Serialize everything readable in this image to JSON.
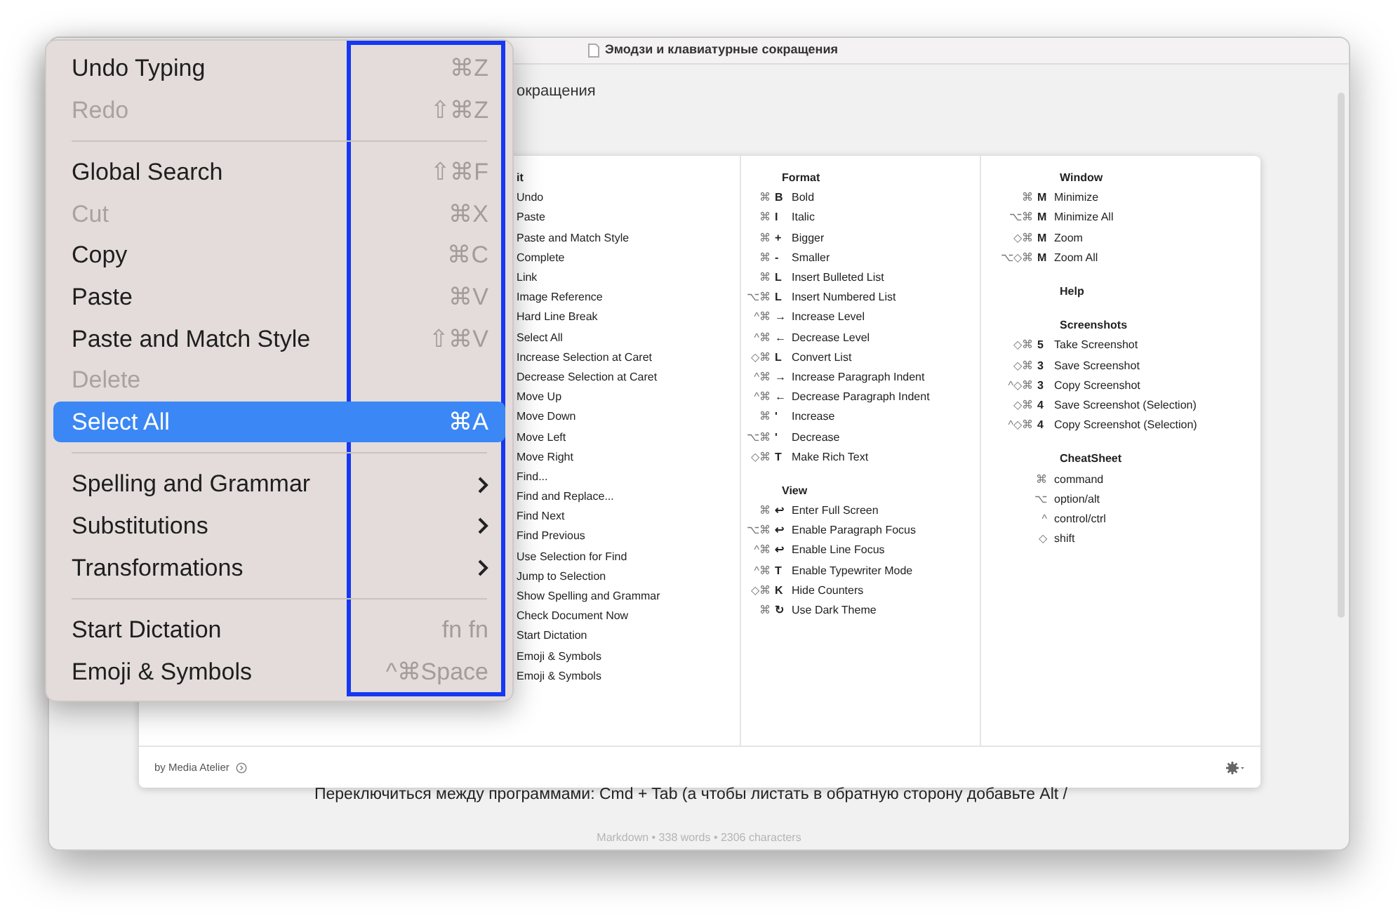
{
  "window": {
    "title": "Эмодзи и клавиатурные сокращения"
  },
  "document": {
    "heading": "окращения",
    "paragraph": "Переключиться между программами: Cmd + Tab (а чтобы листать в обратную сторону добавьте Alt /"
  },
  "cheatsheet": {
    "columns": [
      {
        "sections": [
          {
            "title": "it",
            "items": [
              {
                "label": "Undo"
              },
              {
                "label": "Paste"
              },
              {
                "label": "Paste and Match Style"
              },
              {
                "label": "Complete"
              },
              {
                "label": "Link"
              },
              {
                "label": "Image Reference"
              },
              {
                "label": "Hard Line Break"
              },
              {
                "label": "Select All"
              },
              {
                "label": "Increase Selection at Caret"
              },
              {
                "label": "Decrease Selection at Caret"
              },
              {
                "label": "Move Up"
              },
              {
                "label": "Move Down"
              },
              {
                "label": "Move Left"
              },
              {
                "label": "Move Right"
              },
              {
                "label": "Find..."
              },
              {
                "label": "Find and Replace..."
              },
              {
                "label": "Find Next"
              },
              {
                "label": "Find Previous"
              },
              {
                "label": "Use Selection for Find"
              },
              {
                "label": "Jump to Selection"
              },
              {
                "label": "Show Spelling and Grammar"
              },
              {
                "label": "Check Document Now"
              },
              {
                "label": "Start Dictation"
              },
              {
                "label": "Emoji & Symbols"
              },
              {
                "label": "Emoji & Symbols"
              }
            ]
          }
        ]
      },
      {
        "sections": [
          {
            "title": "Format",
            "items": [
              {
                "mods": "⌘",
                "key": "B",
                "label": "Bold"
              },
              {
                "mods": "⌘",
                "key": "I",
                "label": "Italic"
              },
              {
                "mods": "⌘",
                "key": "+",
                "label": "Bigger"
              },
              {
                "mods": "⌘",
                "key": "-",
                "label": "Smaller"
              },
              {
                "mods": "⌘",
                "key": "L",
                "label": "Insert Bulleted List"
              },
              {
                "mods": "⌥⌘",
                "key": "L",
                "label": "Insert Numbered List"
              },
              {
                "mods": "^⌘",
                "key": "→",
                "label": "Increase Level"
              },
              {
                "mods": "^⌘",
                "key": "←",
                "label": "Decrease Level"
              },
              {
                "mods": "◇⌘",
                "key": "L",
                "label": "Convert List"
              },
              {
                "mods": "^⌘",
                "key": "→",
                "label": "Increase Paragraph Indent"
              },
              {
                "mods": "^⌘",
                "key": "←",
                "label": "Decrease Paragraph Indent"
              },
              {
                "mods": "⌘",
                "key": "'",
                "label": "Increase"
              },
              {
                "mods": "⌥⌘",
                "key": "'",
                "label": "Decrease"
              },
              {
                "mods": "◇⌘",
                "key": "T",
                "label": "Make Rich Text"
              }
            ]
          },
          {
            "title": "View",
            "items": [
              {
                "mods": "⌘",
                "key": "↩",
                "label": "Enter Full Screen"
              },
              {
                "mods": "⌥⌘",
                "key": "↩",
                "label": "Enable Paragraph Focus"
              },
              {
                "mods": "^⌘",
                "key": "↩",
                "label": "Enable Line Focus"
              },
              {
                "mods": "^⌘",
                "key": "T",
                "label": "Enable Typewriter Mode"
              },
              {
                "mods": "◇⌘",
                "key": "K",
                "label": "Hide Counters"
              },
              {
                "mods": "⌘",
                "key": "↻",
                "label": "Use Dark Theme"
              }
            ]
          }
        ]
      },
      {
        "sections": [
          {
            "title": "Window",
            "items": [
              {
                "mods": "⌘",
                "key": "M",
                "label": "Minimize"
              },
              {
                "mods": "⌥⌘",
                "key": "M",
                "label": "Minimize All"
              },
              {
                "mods": "◇⌘",
                "key": "M",
                "label": "Zoom"
              },
              {
                "mods": "⌥◇⌘",
                "key": "M",
                "label": "Zoom All"
              }
            ]
          },
          {
            "title": "Help"
          },
          {
            "title": "Screenshots",
            "items": [
              {
                "mods": "◇⌘",
                "key": "5",
                "label": "Take Screenshot"
              },
              {
                "mods": "◇⌘",
                "key": "3",
                "label": "Save Screenshot"
              },
              {
                "mods": "^◇⌘",
                "key": "3",
                "label": "Copy Screenshot"
              },
              {
                "mods": "◇⌘",
                "key": "4",
                "label": "Save Screenshot (Selection)"
              },
              {
                "mods": "^◇⌘",
                "key": "4",
                "label": "Copy Screenshot (Selection)"
              }
            ]
          },
          {
            "title": "CheatSheet",
            "items": [
              {
                "mods": "⌘",
                "label": "command"
              },
              {
                "mods": "⌥",
                "label": "option/alt"
              },
              {
                "mods": "^",
                "label": "control/ctrl"
              },
              {
                "mods": "◇",
                "label": "shift"
              }
            ]
          }
        ]
      }
    ],
    "footer": "by Media Atelier"
  },
  "status_bar": "Markdown • 338 words • 2306 characters",
  "context_menu": {
    "items": [
      {
        "kind": "item",
        "label": "Undo Typing",
        "shortcut": "⌘Z",
        "disabled": false,
        "selected": false
      },
      {
        "kind": "item",
        "label": "Redo",
        "shortcut": "⇧⌘Z",
        "disabled": true,
        "selected": false
      },
      {
        "kind": "separator"
      },
      {
        "kind": "item",
        "label": "Global Search",
        "shortcut": "⇧⌘F",
        "disabled": false,
        "selected": false
      },
      {
        "kind": "item",
        "label": "Cut",
        "shortcut": "⌘X",
        "disabled": true,
        "selected": false
      },
      {
        "kind": "item",
        "label": "Copy",
        "shortcut": "⌘C",
        "disabled": false,
        "selected": false
      },
      {
        "kind": "item",
        "label": "Paste",
        "shortcut": "⌘V",
        "disabled": false,
        "selected": false
      },
      {
        "kind": "item",
        "label": "Paste and Match Style",
        "shortcut": "⇧⌘V",
        "disabled": false,
        "selected": false
      },
      {
        "kind": "item",
        "label": "Delete",
        "disabled": true,
        "selected": false
      },
      {
        "kind": "item",
        "label": "Select All",
        "shortcut": "⌘A",
        "disabled": false,
        "selected": true
      },
      {
        "kind": "separator"
      },
      {
        "kind": "submenu",
        "label": "Spelling and Grammar",
        "disabled": false,
        "selected": false
      },
      {
        "kind": "submenu",
        "label": "Substitutions",
        "disabled": false,
        "selected": false
      },
      {
        "kind": "submenu",
        "label": "Transformations",
        "disabled": false,
        "selected": false
      },
      {
        "kind": "separator"
      },
      {
        "kind": "item",
        "label": "Start Dictation",
        "shortcut": "fn fn",
        "disabled": false,
        "selected": false
      },
      {
        "kind": "item",
        "label": "Emoji & Symbols",
        "shortcut": "^⌘Space",
        "disabled": false,
        "selected": false
      }
    ]
  }
}
